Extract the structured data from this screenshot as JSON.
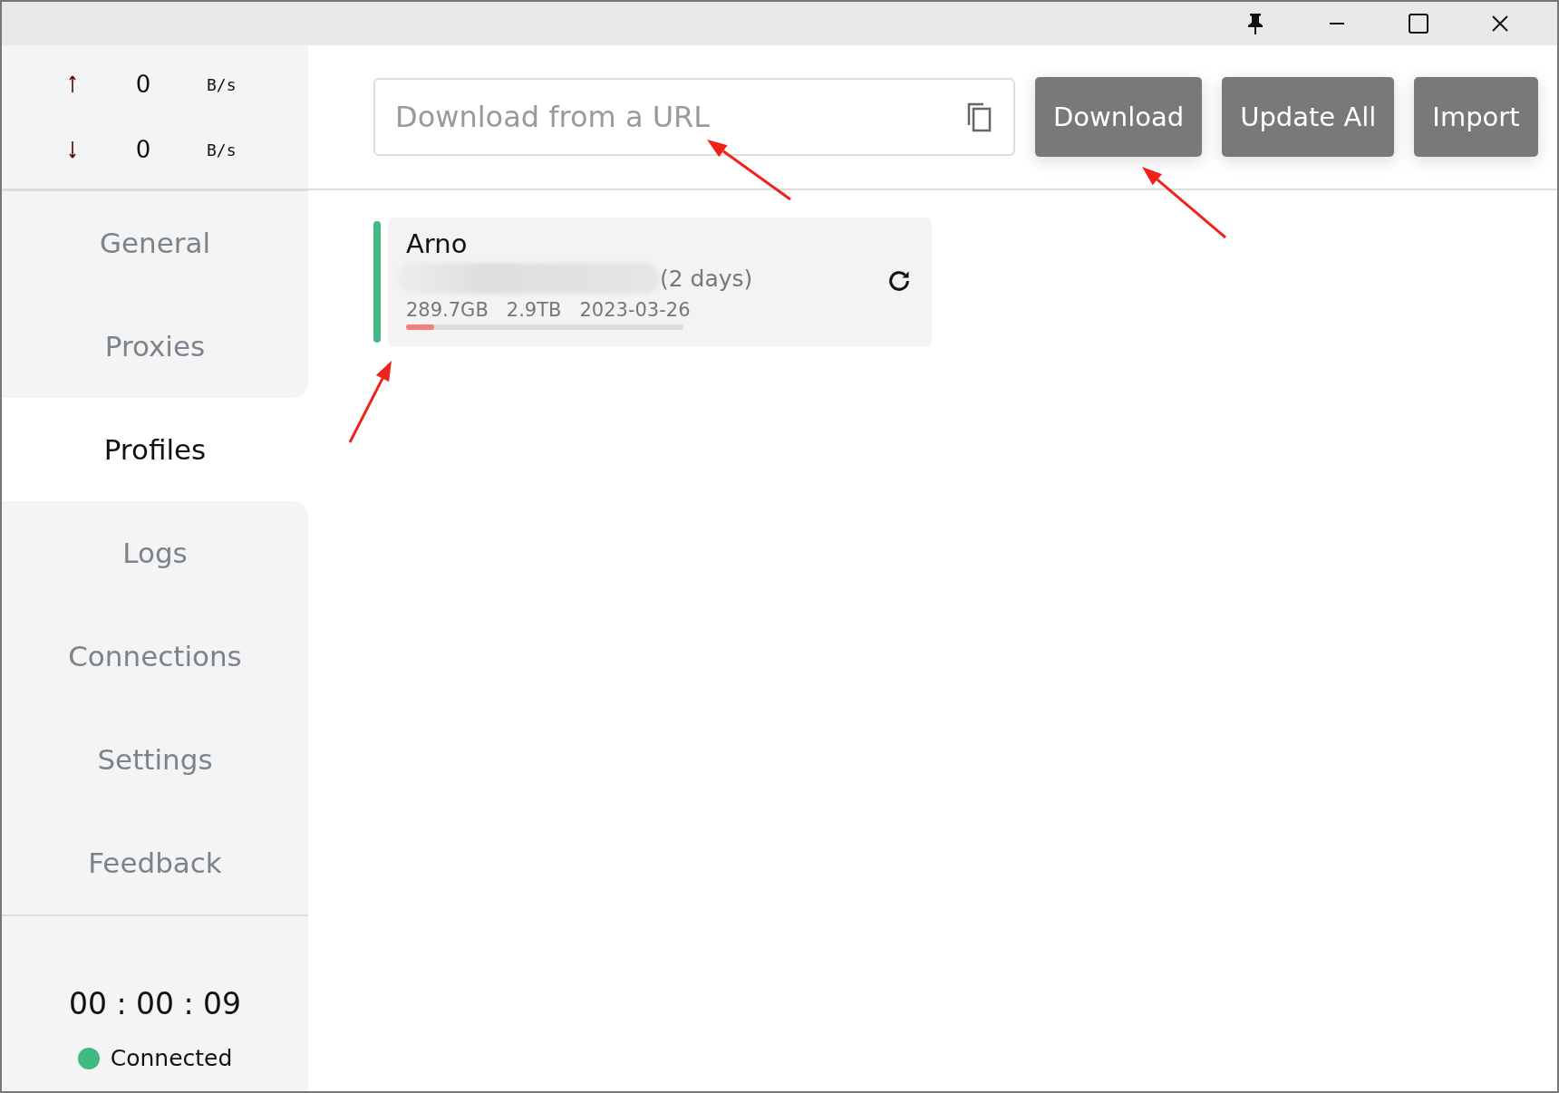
{
  "traffic": [
    {
      "kind": "up",
      "value": "0",
      "unit": "B/s"
    },
    {
      "kind": "down",
      "value": "0",
      "unit": "B/s"
    }
  ],
  "nav": [
    {
      "label": "General",
      "selected": false
    },
    {
      "label": "Proxies",
      "selected": false
    },
    {
      "label": "Profiles",
      "selected": true
    },
    {
      "label": "Logs",
      "selected": false
    },
    {
      "label": "Connections",
      "selected": false
    },
    {
      "label": "Settings",
      "selected": false
    },
    {
      "label": "Feedback",
      "selected": false
    }
  ],
  "uptime": "00 : 00 : 09",
  "status": {
    "label": "Connected",
    "color": "#43b883"
  },
  "url_field": {
    "placeholder": "Download from a URL"
  },
  "buttons": [
    "Download",
    "Update All",
    "Import"
  ],
  "profiles": [
    {
      "name": "Arno",
      "selected": true,
      "expiry": "(2 days)",
      "used": "289.7GB",
      "total": "2.9TB",
      "date": "2023-03-26",
      "level": 0.1
    }
  ]
}
